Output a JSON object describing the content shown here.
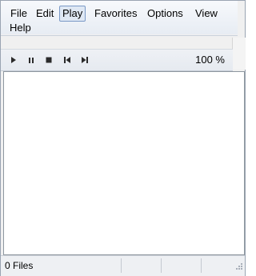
{
  "menubar": {
    "items": [
      {
        "label": "File"
      },
      {
        "label": "Edit"
      },
      {
        "label": "Play"
      },
      {
        "label": "Favorites"
      },
      {
        "label": "Options"
      },
      {
        "label": "View"
      },
      {
        "label": "Help"
      }
    ]
  },
  "toolbar": {
    "buttons": [
      {
        "icon": "play-icon"
      },
      {
        "icon": "pause-icon"
      },
      {
        "icon": "stop-icon"
      },
      {
        "icon": "previous-icon"
      },
      {
        "icon": "next-icon"
      }
    ],
    "zoom": "100 %"
  },
  "status": {
    "files": "0 Files"
  }
}
